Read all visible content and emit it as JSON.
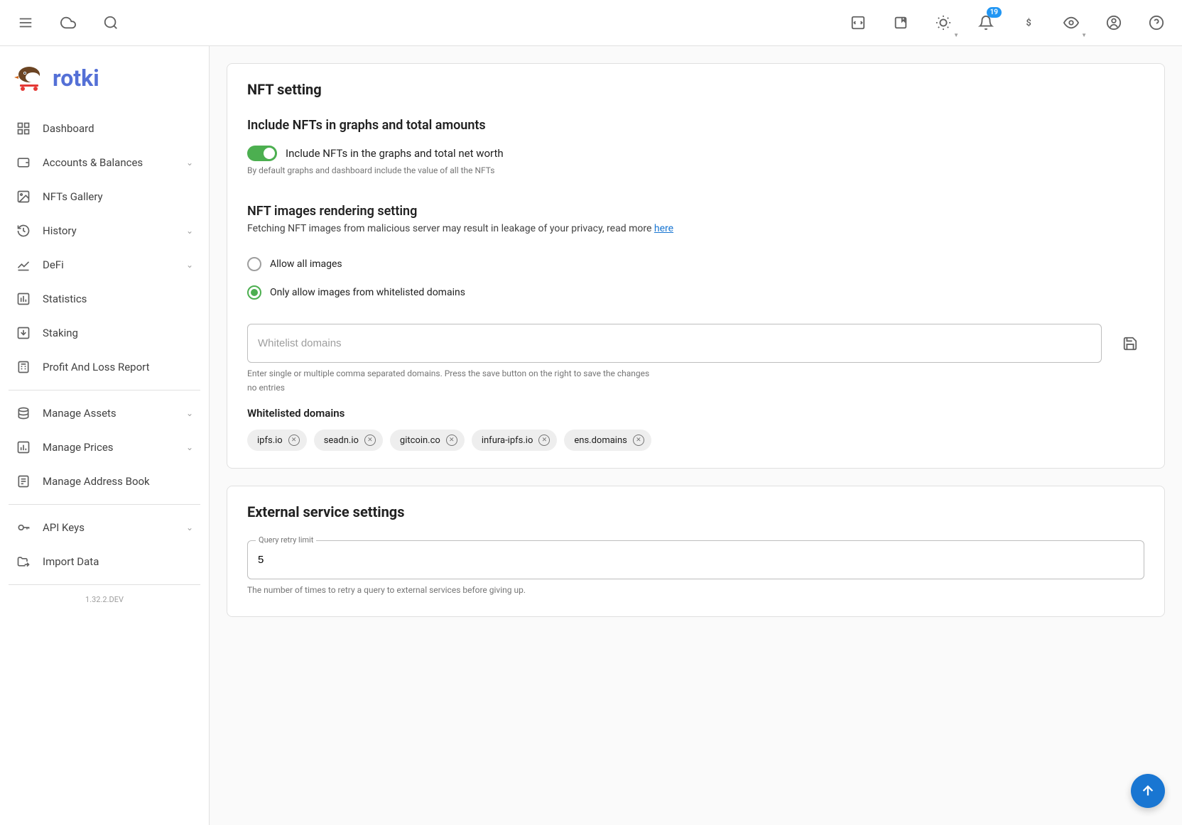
{
  "topbar": {
    "notification_count": "19"
  },
  "brand": {
    "name": "rotki"
  },
  "sidebar": {
    "items": [
      {
        "label": "Dashboard",
        "expandable": false
      },
      {
        "label": "Accounts & Balances",
        "expandable": true
      },
      {
        "label": "NFTs Gallery",
        "expandable": false
      },
      {
        "label": "History",
        "expandable": true
      },
      {
        "label": "DeFi",
        "expandable": true
      },
      {
        "label": "Statistics",
        "expandable": false
      },
      {
        "label": "Staking",
        "expandable": false
      },
      {
        "label": "Profit And Loss Report",
        "expandable": false
      }
    ],
    "items2": [
      {
        "label": "Manage Assets",
        "expandable": true
      },
      {
        "label": "Manage Prices",
        "expandable": true
      },
      {
        "label": "Manage Address Book",
        "expandable": false
      }
    ],
    "items3": [
      {
        "label": "API Keys",
        "expandable": true
      },
      {
        "label": "Import Data",
        "expandable": false
      }
    ],
    "version": "1.32.2.DEV"
  },
  "nft_card": {
    "title": "NFT setting",
    "section1_heading": "Include NFTs in graphs and total amounts",
    "toggle_label": "Include NFTs in the graphs and total net worth",
    "toggle_helper": "By default graphs and dashboard include the value of all the NFTs",
    "section2_heading": "NFT images rendering setting",
    "section2_desc": "Fetching NFT images from malicious server may result in leakage of your privacy, read more ",
    "section2_link": "here",
    "radio_allow_all": "Allow all images",
    "radio_whitelist": "Only allow images from whitelisted domains",
    "whitelist_placeholder": "Whitelist domains",
    "whitelist_hint": "Enter single or multiple comma separated domains. Press the save button on the right to save the changes",
    "no_entries": "no entries",
    "whitelisted_heading": "Whitelisted domains",
    "domains": [
      "ipfs.io",
      "seadn.io",
      "gitcoin.co",
      "infura-ipfs.io",
      "ens.domains"
    ]
  },
  "external_card": {
    "title": "External service settings",
    "retry_label": "Query retry limit",
    "retry_value": "5",
    "retry_helper": "The number of times to retry a query to external services before giving up."
  }
}
